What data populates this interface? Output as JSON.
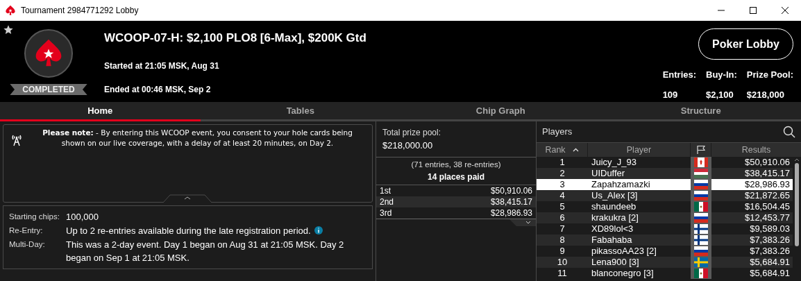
{
  "window": {
    "title": "Tournament 2984771292 Lobby"
  },
  "header": {
    "favorite": false,
    "status": "COMPLETED",
    "title": "WCOOP-07-H: $2,100 PLO8 [6-Max], $200K Gtd",
    "started": "Started at 21:05 MSK, Aug 31",
    "ended": "Ended at 00:46 MSK, Sep 2",
    "lobby_button": "Poker Lobby",
    "stats": [
      {
        "label": "Entries:",
        "value": "109"
      },
      {
        "label": "Buy-In:",
        "value": "$2,100"
      },
      {
        "label": "Prize Pool:",
        "value": "$218,000"
      }
    ]
  },
  "tabs": [
    {
      "label": "Home",
      "selected": true
    },
    {
      "label": "Tables",
      "selected": false
    },
    {
      "label": "Chip Graph",
      "selected": false
    },
    {
      "label": "Structure",
      "selected": false
    }
  ],
  "note": "**Please note:** - By entering this WCOOP event, you consent to your hole cards being shown on our live coverage, with a delay of at least 20 minutes, on Day 2.",
  "details": [
    {
      "label": "Starting chips:",
      "value": "100,000",
      "info": false
    },
    {
      "label": "Re-Entry:",
      "value": "Up to 2 re-entries available during the late registration period.",
      "info": true
    },
    {
      "label": "Multi-Day:",
      "value": "This was a 2-day event. Day 1 began on Aug 31 at 21:05 MSK. Day 2 began on Sep 1 at 21:05 MSK.",
      "info": false
    }
  ],
  "prizes": {
    "total_label": "Total prize pool:",
    "total": "$218,000.00",
    "entries": "(71 entries, 38 re-entries)",
    "places_paid": "14 places paid",
    "rows": [
      {
        "place": "1st",
        "amount": "$50,910.06"
      },
      {
        "place": "2nd",
        "amount": "$38,415.17"
      },
      {
        "place": "3rd",
        "amount": "$28,986.93"
      }
    ]
  },
  "players": {
    "title": "Players",
    "columns": [
      "Rank",
      "Player",
      "Results"
    ],
    "rows": [
      {
        "rank": "1",
        "player": "Juicy_J_93",
        "flag": {
          "kind": "ca"
        },
        "result": "$50,910.06",
        "selected": false
      },
      {
        "rank": "2",
        "player": "UIDuffer",
        "flag": {
          "kind": "hu"
        },
        "result": "$38,415.17",
        "selected": false
      },
      {
        "rank": "3",
        "player": "Zapahzamazki",
        "flag": {
          "kind": "ru"
        },
        "result": "$28,986.93",
        "selected": true
      },
      {
        "rank": "4",
        "player": "Us_Alex [3]",
        "flag": {
          "kind": "ru"
        },
        "result": "$21,872.65",
        "selected": false
      },
      {
        "rank": "5",
        "player": "shaundeeb",
        "flag": {
          "kind": "mx"
        },
        "result": "$16,504.45",
        "selected": false
      },
      {
        "rank": "6",
        "player": "krakukra [2]",
        "flag": {
          "kind": "ru"
        },
        "result": "$12,453.77",
        "selected": false
      },
      {
        "rank": "7",
        "player": "XD89lol<3",
        "flag": {
          "kind": "fi"
        },
        "result": "$9,589.03",
        "selected": false
      },
      {
        "rank": "8",
        "player": "Fabahaba",
        "flag": {
          "kind": "fi"
        },
        "result": "$7,383.26",
        "selected": false
      },
      {
        "rank": "9",
        "player": "pikassoAA23 [2]",
        "flag": {
          "kind": "ru"
        },
        "result": "$7,383.26",
        "selected": false
      },
      {
        "rank": "10",
        "player": "Lena900 [3]",
        "flag": {
          "kind": "se"
        },
        "result": "$5,684.91",
        "selected": false
      },
      {
        "rank": "11",
        "player": "blanconegro [3]",
        "flag": {
          "kind": "mx"
        },
        "result": "$5,684.91",
        "selected": false
      }
    ]
  }
}
